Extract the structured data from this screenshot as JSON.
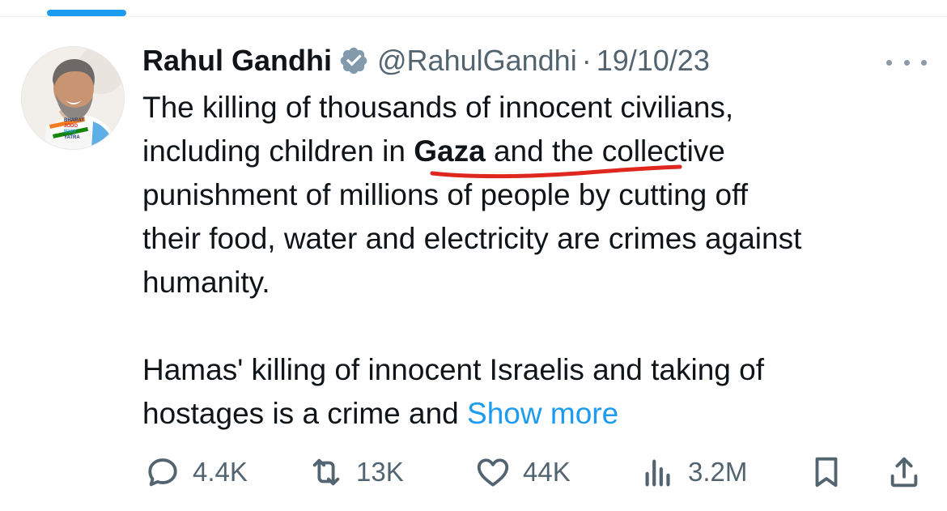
{
  "author": {
    "name": "Rahul Gandhi",
    "handle": "@RahulGandhi",
    "separator": "·",
    "date": "19/10/23"
  },
  "avatar": {
    "badge_lines": [
      "BHARAT",
      "JODO",
      "NYAY",
      "YATRA"
    ]
  },
  "tweet": {
    "lines": [
      "The killing of thousands of innocent civilians,",
      {
        "before": "including children in ",
        "bold": "Gaza",
        "after": " and the collective"
      },
      "punishment of millions of people by cutting off",
      "their food, water and electricity are crimes against",
      "humanity.",
      "",
      "Hamas' killing of innocent Israelis and taking of",
      "hostages is a crime and "
    ],
    "show_more": "Show more"
  },
  "actions": {
    "replies": "4.4K",
    "reposts": "13K",
    "likes": "44K",
    "views": "3.2M"
  },
  "colors": {
    "accent": "#1d9bf0",
    "text": "#0f1419",
    "muted": "#536471",
    "annotation": "#e0271f"
  },
  "icons": {
    "verified": "verified-badge-icon",
    "more": "more-horizontal-icon",
    "reply": "reply-icon",
    "repost": "repost-icon",
    "like": "heart-icon",
    "views": "analytics-icon",
    "bookmark": "bookmark-icon",
    "share": "share-icon"
  }
}
